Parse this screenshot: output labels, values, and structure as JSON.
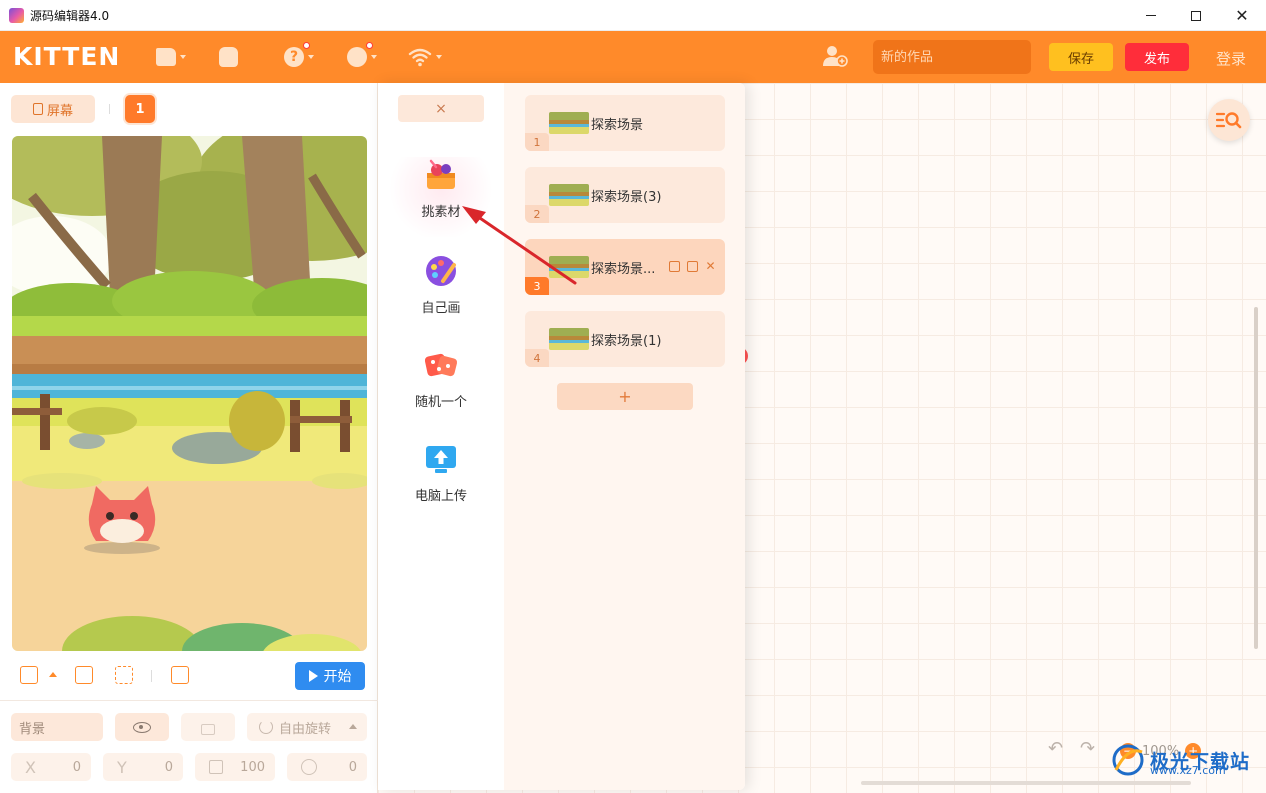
{
  "window": {
    "title": "源码编辑器4.0"
  },
  "toolbar": {
    "brand": "KITTEN",
    "help_glyph": "?",
    "work_name_placeholder": "新的作品",
    "save_label": "保存",
    "publish_label": "发布",
    "login_label": "登录",
    "icons": [
      "file-icon",
      "backpack-icon",
      "help-icon",
      "settings-icon",
      "wifi-icon",
      "add-user-icon"
    ],
    "accent_color": "#ff8a2a"
  },
  "stage_panel": {
    "screen_label": "屏幕",
    "screen_number": "1",
    "start_label": "开始",
    "props": {
      "background_label": "背景",
      "rotate_label": "自由旋转",
      "x_label": "X",
      "x_value": "0",
      "y_label": "Y",
      "y_value": "0",
      "size_value": "100",
      "direction_value": "0"
    }
  },
  "popover": {
    "close_label": "×",
    "sources": [
      {
        "label": "挑素材",
        "icon": "material-box-icon"
      },
      {
        "label": "自己画",
        "icon": "palette-icon"
      },
      {
        "label": "随机一个",
        "icon": "dice-icon"
      },
      {
        "label": "电脑上传",
        "icon": "upload-icon"
      }
    ],
    "scenes": [
      {
        "number": "1",
        "name": "探索场景",
        "selected": false
      },
      {
        "number": "2",
        "name": "探索场景(3)",
        "selected": false
      },
      {
        "number": "3",
        "name": "探索场景...",
        "selected": true
      },
      {
        "number": "4",
        "name": "探索场景(1)",
        "selected": false
      }
    ],
    "add_label": "+"
  },
  "workspace": {
    "zoom_label": "100%"
  },
  "watermark": {
    "brand": "极光下载站",
    "url": "www.xz7.com"
  }
}
